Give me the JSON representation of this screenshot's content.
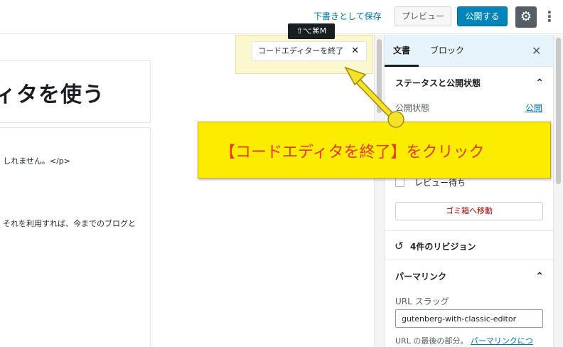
{
  "toolbar": {
    "save_draft_label": "下書きとして保存",
    "preview_label": "プレビュー",
    "publish_label": "公開する",
    "settings_icon": "gear-icon",
    "more_icon": "vertical-ellipsis-icon"
  },
  "editor": {
    "title_fragment": "ィタを使う",
    "code_line_1": "しれません。</p>",
    "code_line_2": "それを利用すれば、今までのブログと"
  },
  "code_editor_bar": {
    "exit_label": "コードエディターを終了",
    "close_icon": "close-icon",
    "shortcut": "⇧⌥⌘M"
  },
  "sidebar": {
    "tab_document": "文書",
    "tab_block": "ブロック",
    "status_panel": {
      "title": "ステータスと公開状態",
      "visibility_label": "公開状態",
      "visibility_value": "公開",
      "pending_review_label": "レビュー待ち",
      "pending_review_checked": false,
      "trash_label": "ゴミ箱へ移動"
    },
    "revisions_label": "4件のリビジョン",
    "permalink_panel": {
      "title": "パーマリンク",
      "slug_label": "URL スラッグ",
      "slug_value": "gutenberg-with-classic-editor",
      "note_prefix": "URL の最後の部分。",
      "note_link": "パーマリンクにつ"
    }
  },
  "annotation": {
    "text": "【コードエディタを終了】をクリック"
  },
  "colors": {
    "accent": "#0085ba",
    "callout_background": "#fcec00",
    "callout_text": "#e8382c",
    "arrow": "#f5e12a"
  }
}
